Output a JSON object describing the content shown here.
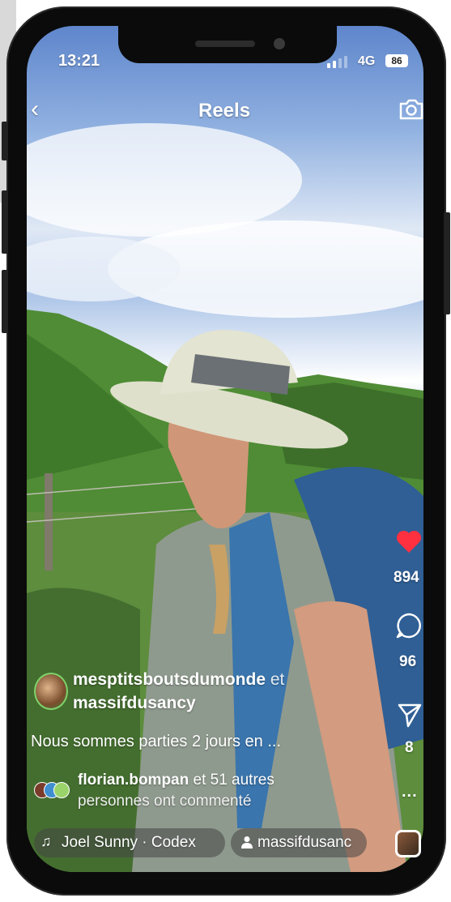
{
  "status_bar": {
    "time": "13:21",
    "network": "4G",
    "battery": "86",
    "signal_bars": 4,
    "signal_active": 2
  },
  "header": {
    "back_icon": "chevron-left-icon",
    "title": "Reels",
    "camera_icon": "camera-icon"
  },
  "actions": {
    "like_icon": "heart-icon",
    "like_count": "894",
    "comment_icon": "comment-icon",
    "comment_count": "96",
    "share_icon": "send-icon",
    "share_count": "8",
    "more_label": "..."
  },
  "post": {
    "author": "mesptitsboutsdumonde",
    "joiner": "et",
    "collaborator": "massifdusancy",
    "caption": "Nous sommes parties 2 jours en ...",
    "commenter": "florian.bompan",
    "comment_rest": "et 51 autres",
    "comment_line2": "personnes ont commenté"
  },
  "footer": {
    "music_icon": "music-note-icon",
    "music": "Joel Sunny · Codex",
    "tag_icon": "person-icon",
    "tag": "massifdusanc"
  },
  "colors": {
    "like": "#ff3040",
    "avatar_ring": "#7ed36b"
  }
}
